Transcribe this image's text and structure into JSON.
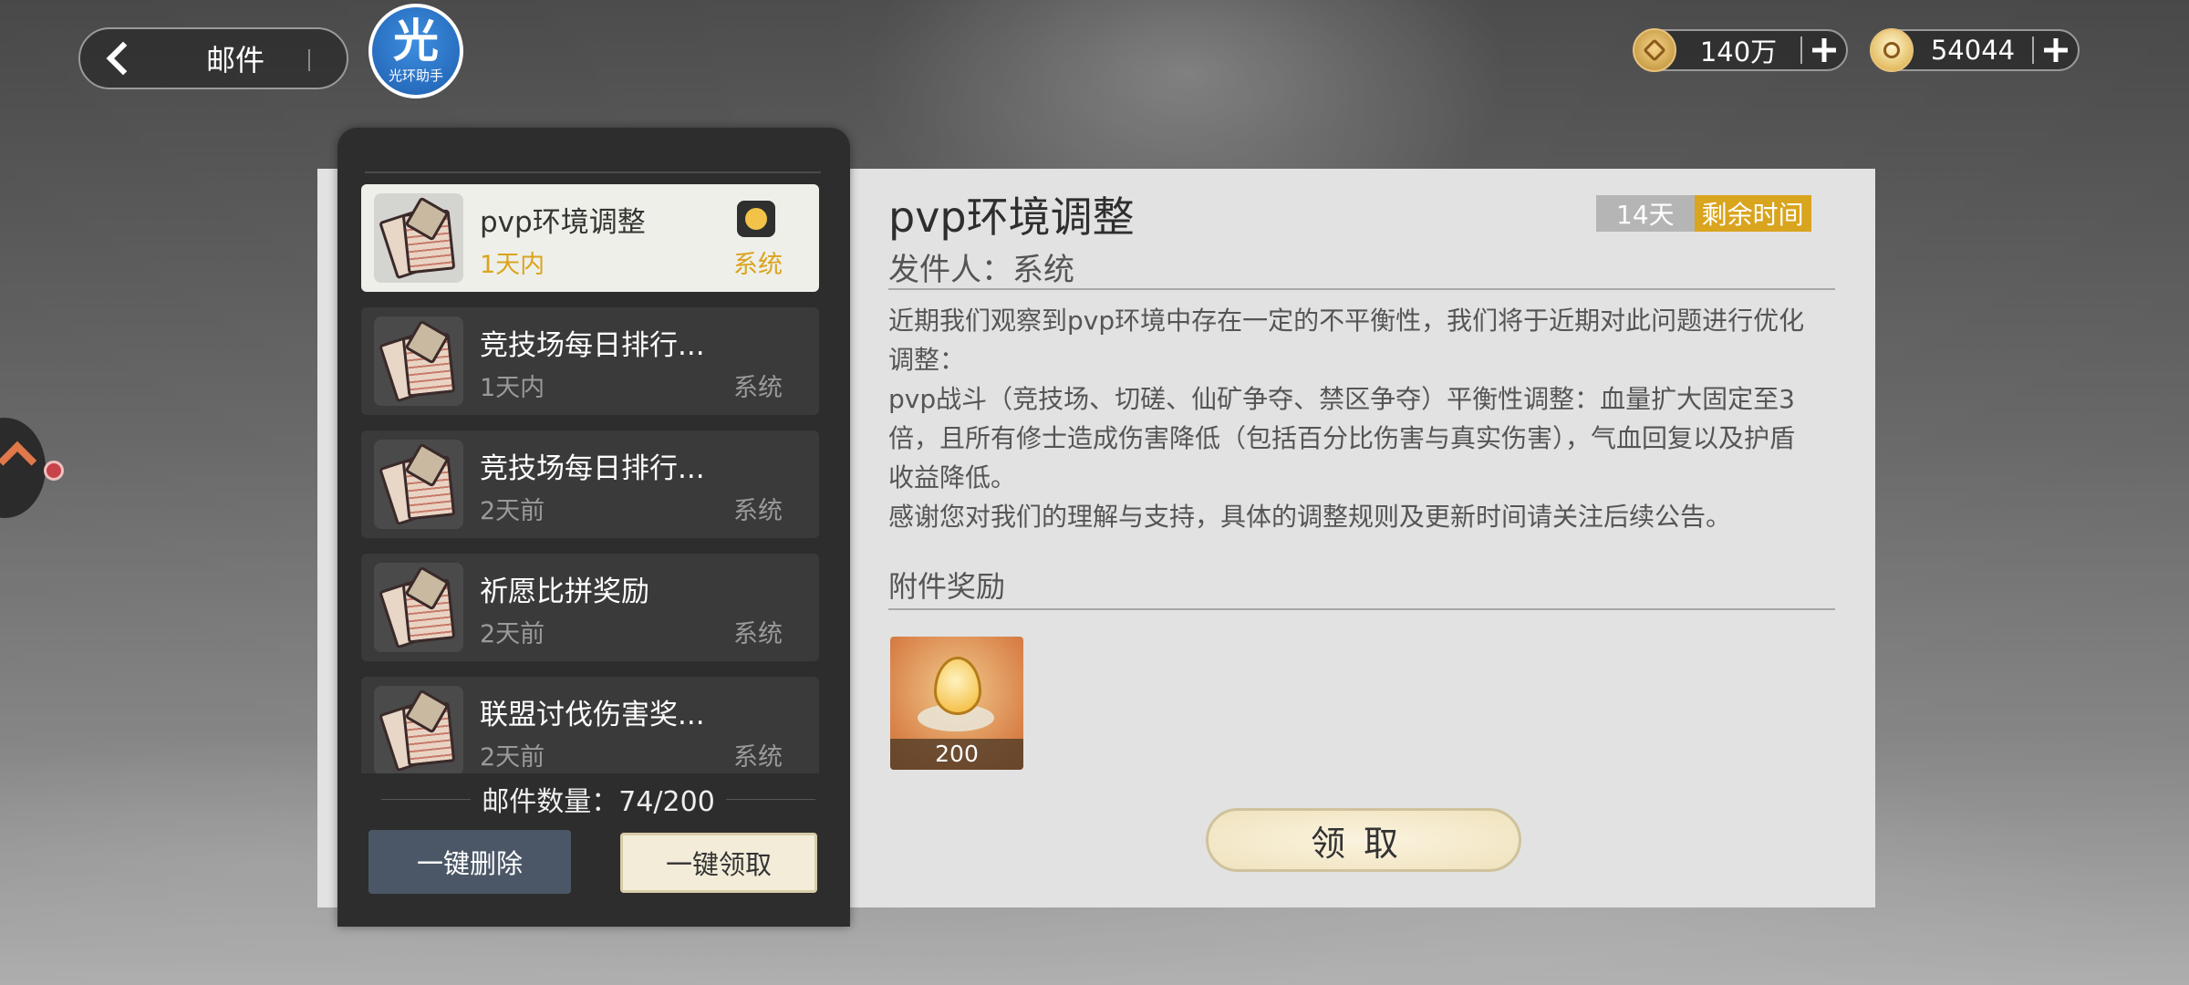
{
  "header": {
    "title": "邮件",
    "helper_badge_big": "光",
    "helper_badge_small": "光环助手"
  },
  "currencies": [
    {
      "name": "coin",
      "icon": "coin-icon",
      "value": "140万"
    },
    {
      "name": "drop",
      "icon": "spirit-drop-icon",
      "value": "54044"
    }
  ],
  "mail_list": {
    "items": [
      {
        "title": "pvp环境调整",
        "time": "1天内",
        "sender": "系统",
        "active": true,
        "has_reward": true
      },
      {
        "title": "竞技场每日排行...",
        "time": "1天内",
        "sender": "系统",
        "active": false
      },
      {
        "title": "竞技场每日排行...",
        "time": "2天前",
        "sender": "系统",
        "active": false
      },
      {
        "title": "祈愿比拼奖励",
        "time": "2天前",
        "sender": "系统",
        "active": false
      },
      {
        "title": "联盟讨伐伤害奖...",
        "time": "2天前",
        "sender": "系统",
        "active": false
      }
    ],
    "count_text": "邮件数量：74/200",
    "delete_all_label": "一键删除",
    "claim_all_label": "一键领取"
  },
  "detail": {
    "title": "pvp环境调整",
    "remaining_days": "14天",
    "remaining_label": "剩余时间",
    "sender_line": "发件人：系统",
    "body": [
      "近期我们观察到pvp环境中存在一定的不平衡性，我们将于近期对此问题进行优化调整：",
      "pvp战斗（竞技场、切磋、仙矿争夺、禁区争夺）平衡性调整：血量扩大固定至3倍，且所有修士造成伤害降低（包括百分比伤害与真实伤害），气血回复以及护盾收益降低。",
      "感谢您对我们的理解与支持，具体的调整规则及更新时间请关注后续公告。"
    ],
    "attachment_title": "附件奖励",
    "attachment": {
      "icon": "spirit-drop-icon",
      "quantity": "200"
    },
    "claim_label": "领取"
  }
}
